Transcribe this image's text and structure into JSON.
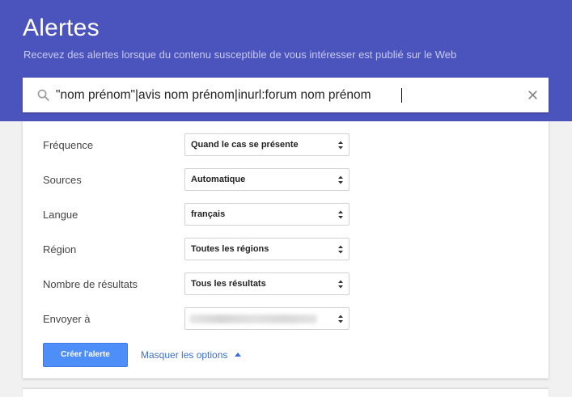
{
  "header": {
    "title": "Alertes",
    "subtitle": "Recevez des alertes lorsque du contenu susceptible de vous intéresser est publié sur le Web"
  },
  "search": {
    "value": "\"nom prénom\"|avis nom prénom|inurl:forum nom prénom",
    "search_icon": "search-icon",
    "clear_icon": "close-icon"
  },
  "options": {
    "rows": [
      {
        "label": "Fréquence",
        "value": "Quand le cas se présente"
      },
      {
        "label": "Sources",
        "value": "Automatique"
      },
      {
        "label": "Langue",
        "value": "français"
      },
      {
        "label": "Région",
        "value": "Toutes les régions"
      },
      {
        "label": "Nombre de résultats",
        "value": "Tous les résultats"
      },
      {
        "label": "Envoyer à",
        "value": ""
      }
    ]
  },
  "actions": {
    "create_label": "Créer l'alerte",
    "hide_options_label": "Masquer les options"
  },
  "colors": {
    "header_bg": "#4b53bc",
    "button_bg": "#4d8ef8",
    "link": "#3b6fd6"
  }
}
